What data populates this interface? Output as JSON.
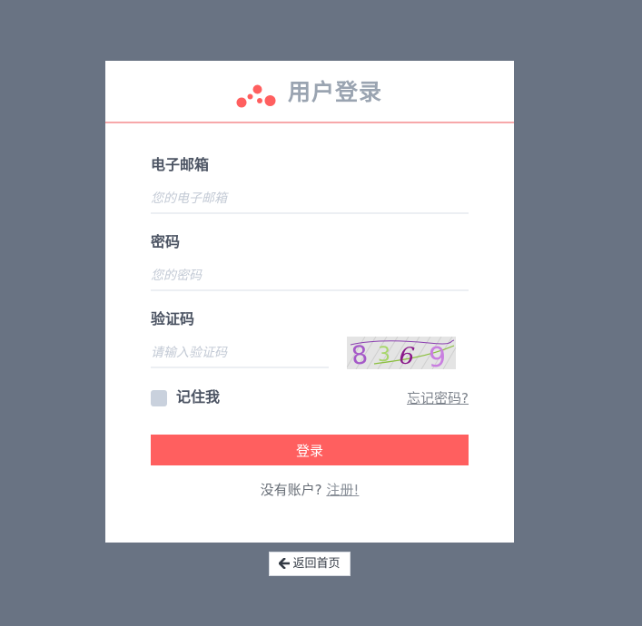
{
  "header": {
    "title": "用户登录",
    "logo_icon": "dots-logo-icon",
    "accent_color": "#ff5f5f"
  },
  "form": {
    "email_label": "电子邮箱",
    "email_placeholder": "您的电子邮箱",
    "email_value": "",
    "password_label": "密码",
    "password_placeholder": "您的密码",
    "password_value": "",
    "captcha_label": "验证码",
    "captcha_placeholder": "请输入验证码",
    "captcha_value": "",
    "captcha_image_text": "8369",
    "remember_label": "记住我",
    "remember_checked": false,
    "forgot_label": "忘记密码?",
    "login_label": "登录"
  },
  "register": {
    "prompt": "没有账户? ",
    "link_label": "注册!"
  },
  "footer": {
    "back_label": "返回首页",
    "back_icon": "arrow-left-icon"
  }
}
